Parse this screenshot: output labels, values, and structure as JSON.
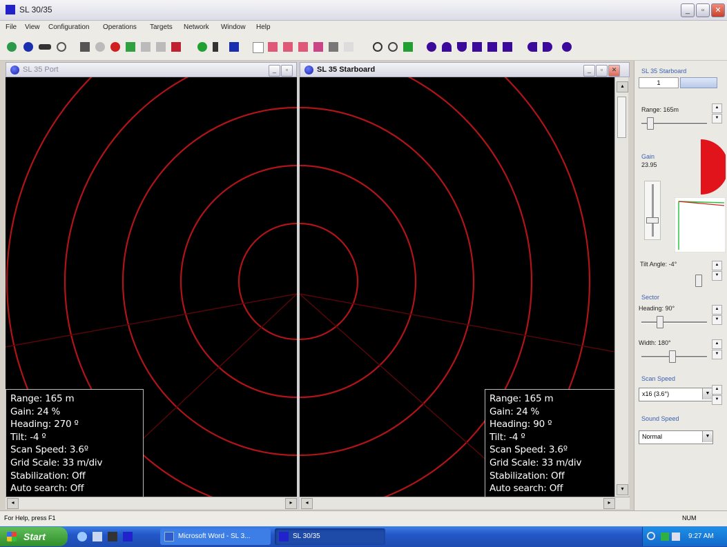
{
  "window": {
    "title": "SL 30/35"
  },
  "menu": [
    "File",
    "View",
    "Configuration",
    "Operations",
    "Targets",
    "Network",
    "Window",
    "Help"
  ],
  "colors": {
    "ring": "#b01418",
    "sector": "#e0141a",
    "panel_accent": "#3a5fb0"
  },
  "port": {
    "title": "SL 35 Port",
    "info": [
      "Range: 165 m",
      "Gain: 24 %",
      "Heading: 270 º",
      "Tilt: -4 º",
      "Scan Speed: 3.6º",
      "Grid Scale: 33 m/div",
      "Stabilization: Off",
      "Auto search: Off"
    ]
  },
  "starboard": {
    "title": "SL 35 Starboard",
    "info": [
      "Range: 165 m",
      "Gain: 24 %",
      "Heading: 90 º",
      "Tilt: -4 º",
      "Scan Speed: 3.6º",
      "Grid Scale: 33 m/div",
      "Stabilization: Off",
      "Auto search: Off"
    ]
  },
  "panel": {
    "title": "SL 35 Starboard",
    "tab_value": "1",
    "range_label": "Range: 165m",
    "gain_label": "Gain",
    "gain_value": "23.95",
    "tilt_label": "Tilt Angle: -4°",
    "sector_group": "Sector",
    "heading_label": "Heading: 90°",
    "width_label": "Width: 180°",
    "scan_speed_group": "Scan Speed",
    "scan_speed_value": "x16 (3.6°)",
    "sound_speed_group": "Sound Speed",
    "sound_speed_value": "Normal"
  },
  "status": {
    "help": "For Help, press F1",
    "num": "NUM"
  },
  "taskbar": {
    "start": "Start",
    "tasks": [
      "Microsoft Word - SL 3...",
      "SL 30/35"
    ],
    "clock": "9:27 AM"
  }
}
